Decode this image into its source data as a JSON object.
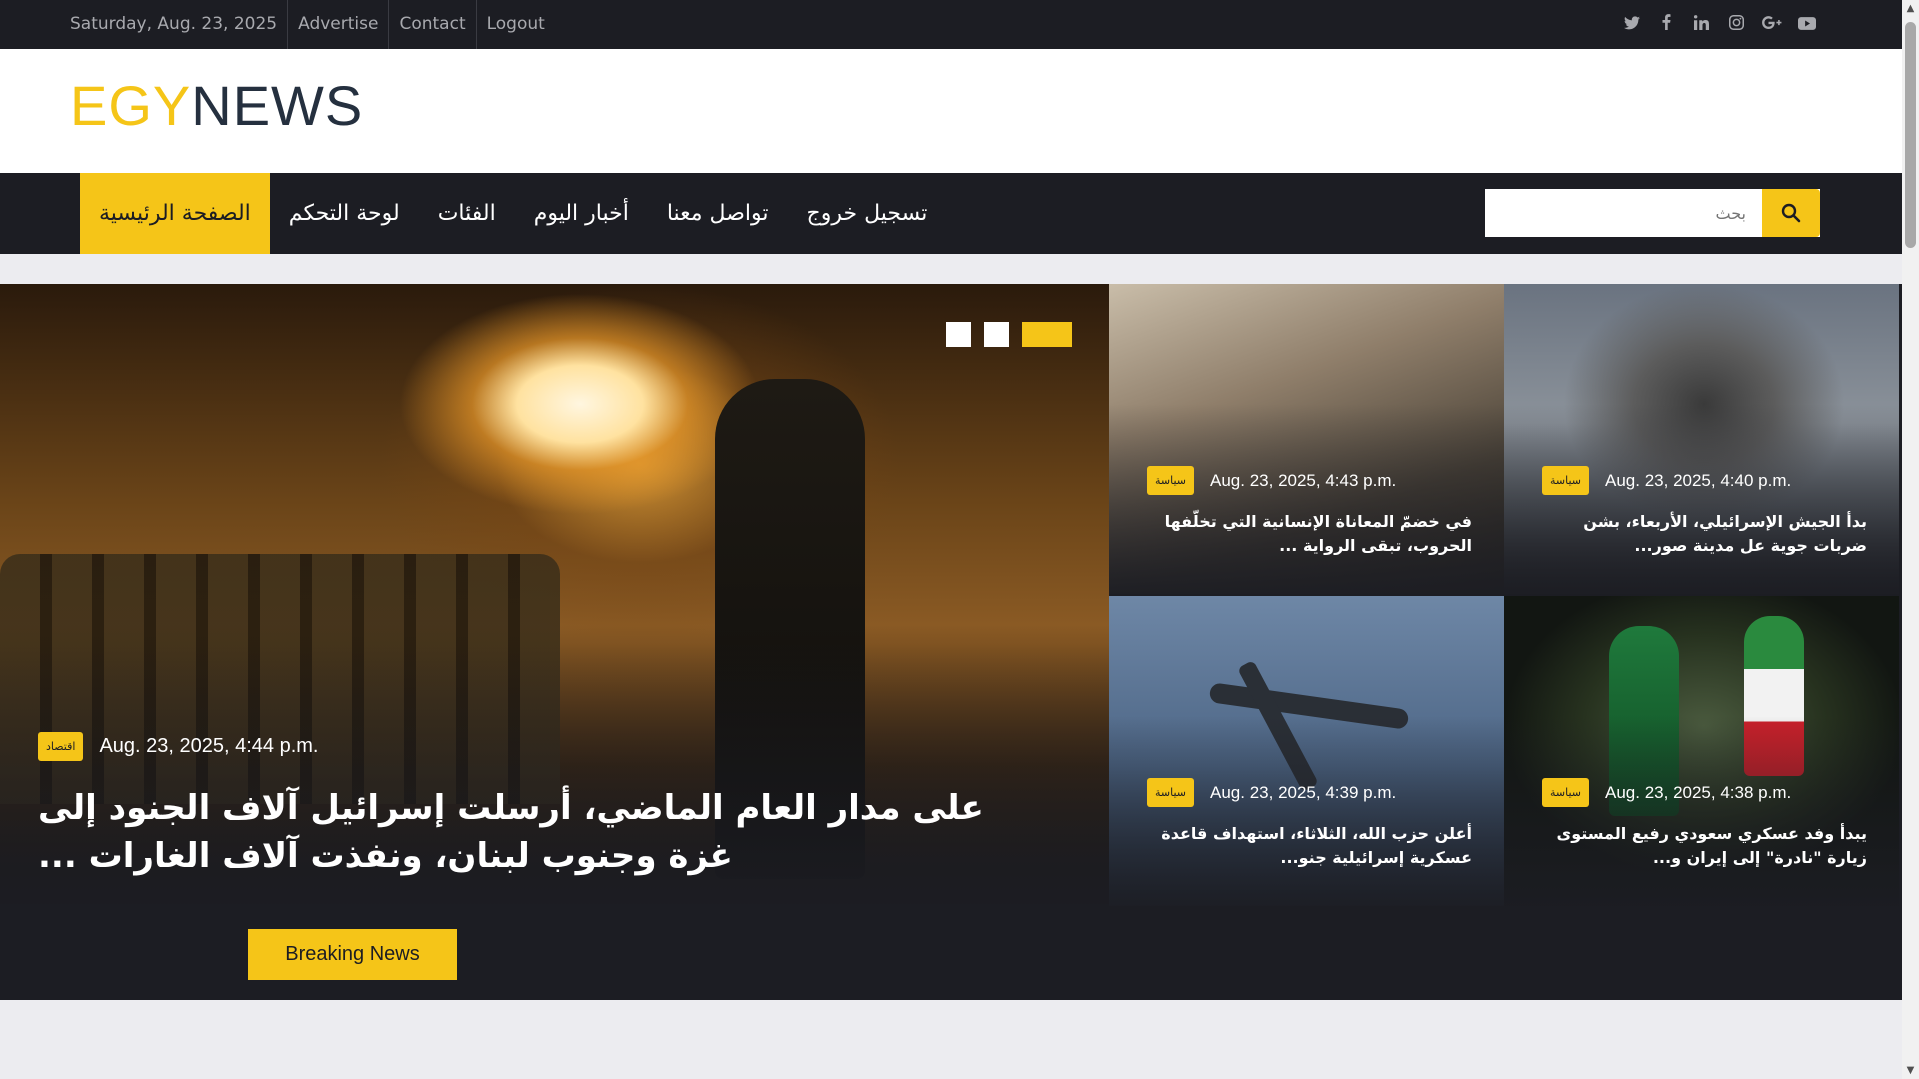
{
  "topbar": {
    "date": "Saturday, Aug. 23, 2025",
    "links": [
      "Advertise",
      "Contact",
      "Logout"
    ],
    "social_icons": [
      "twitter-icon",
      "facebook-icon",
      "linkedin-icon",
      "instagram-icon",
      "google-plus-icon",
      "youtube-icon"
    ]
  },
  "logo": {
    "part1": "EGY",
    "part2": "NEWS"
  },
  "nav": {
    "items": [
      "الصفحة الرئيسية",
      "لوحة التحكم",
      "الفئات",
      "أخبار اليوم",
      "تواصل معنا",
      "تسجيل خروج"
    ],
    "search_placeholder": "بحث"
  },
  "colors": {
    "accent": "#f5c518",
    "dark": "#1c1d23",
    "logo_dark": "#25303f"
  },
  "main_story": {
    "category": "اقتصاد",
    "date": "Aug. 23, 2025, 4:44 p.m.",
    "title": "على مدار العام الماضي، أرسلت إسرائيل آلاف الجنود إلى غزة وجنوب لبنان، ونفذت آلاف الغارات ..."
  },
  "slider_dots": 3,
  "cards": [
    {
      "category": "سياسة",
      "date": "Aug. 23, 2025, 4:43 p.m.",
      "title": "في خضمّ المعاناة الإنسانية التي تخلّفها الحروب، تبقى الرواية ..."
    },
    {
      "category": "سياسة",
      "date": "Aug. 23, 2025, 4:40 p.m.",
      "title": "بدأ الجيش الإسرائيلي، الأربعاء، بشن ضربات جوية عل مدينة صور..."
    },
    {
      "category": "سياسة",
      "date": "Aug. 23, 2025, 4:39 p.m.",
      "title": "أعلن حزب الله، الثلاثاء، استهداف قاعدة عسكرية إسرائيلية جنو..."
    },
    {
      "category": "سياسة",
      "date": "Aug. 23, 2025, 4:38 p.m.",
      "title": "يبدأ وفد عسكري سعودي رفيع المستوى زيارة \"نادرة\" إلى إيران و..."
    }
  ],
  "breaking_news_label": "Breaking News"
}
